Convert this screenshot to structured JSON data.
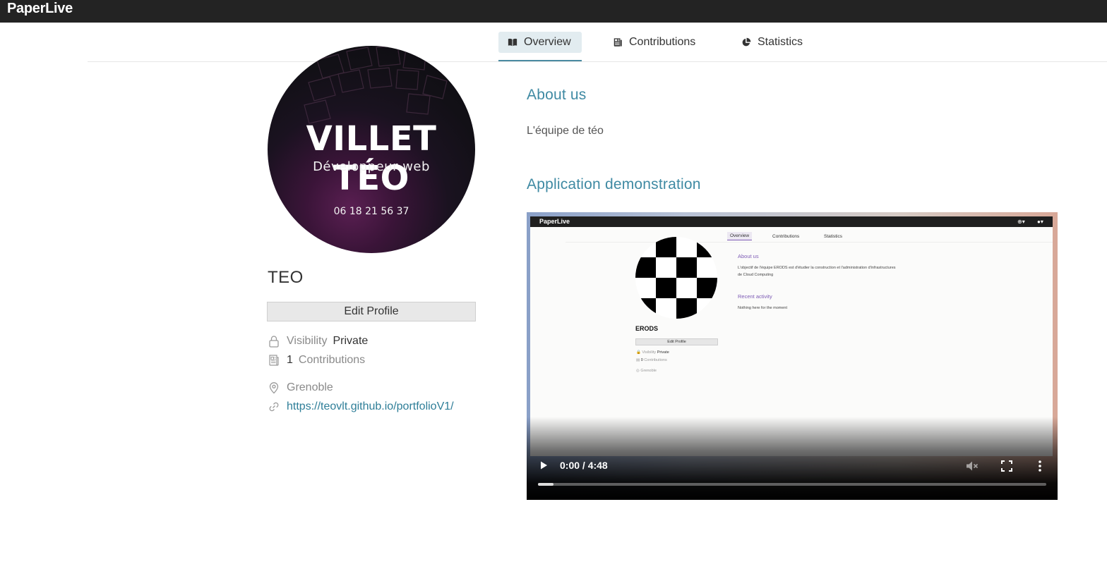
{
  "app": {
    "brand": "PaperLive"
  },
  "tabs": [
    {
      "label": "Overview",
      "icon": "book-icon",
      "active": true
    },
    {
      "label": "Contributions",
      "icon": "newspaper-icon",
      "active": false
    },
    {
      "label": "Statistics",
      "icon": "pie-chart-icon",
      "active": false
    }
  ],
  "profile": {
    "avatar": {
      "title": "VILLET TÉO",
      "subtitle": "Développeur web",
      "phone": "06 18 21 56 37"
    },
    "name": "TEO",
    "edit_label": "Edit Profile",
    "visibility_label": "Visibility",
    "visibility_value": "Private",
    "contributions_count": "1",
    "contributions_label": "Contributions",
    "location": "Grenoble",
    "link": "https://teovlt.github.io/portfolioV1/"
  },
  "about": {
    "heading": "About us",
    "text": "L'équipe de téo"
  },
  "demo": {
    "heading": "Application demonstration",
    "video": {
      "time": "0:00 / 4:48",
      "progress": 0.03,
      "preview": {
        "brand": "PaperLive",
        "tabs": [
          "Overview",
          "Contributions",
          "Statistics"
        ],
        "name": "ERODS",
        "edit_label": "Edit Profile",
        "visibility_label": "Visibility",
        "visibility_value": "Private",
        "contributions_count": "0",
        "contributions_label": "Contributions",
        "location": "Grenoble",
        "about_heading": "About us",
        "about_line1": "L'objectif de l'équipe ERODS est d'étudier la construction et l'administration d'infrastructures",
        "about_line2": "de Cloud Computing",
        "recent_heading": "Recent activity",
        "recent_text": "Nothing here for the moment"
      }
    }
  }
}
